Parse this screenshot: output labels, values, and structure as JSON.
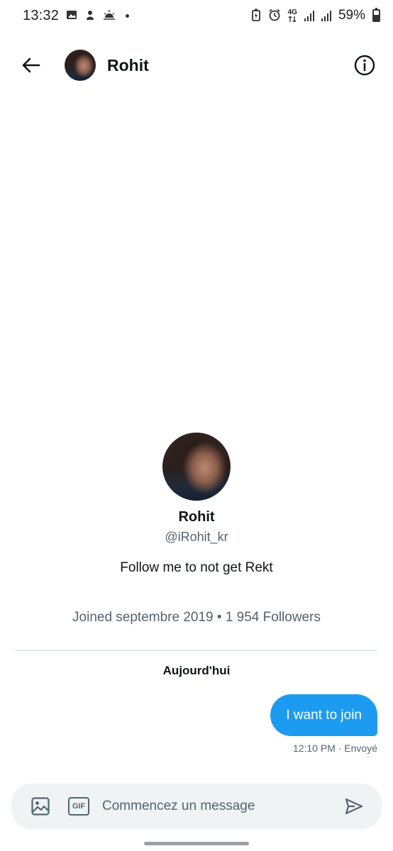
{
  "status_bar": {
    "time": "13:32",
    "network": "4G",
    "battery": "59%",
    "battery_level": 0.59
  },
  "header": {
    "name": "Rohit"
  },
  "profile": {
    "name": "Rohit",
    "handle": "@iRohit_kr",
    "bio": "Follow me to not get Rekt",
    "meta": "Joined septembre 2019 • 1 954 Followers"
  },
  "conversation": {
    "day_label": "Aujourd'hui",
    "messages": [
      {
        "text": "I  want to join",
        "meta": "12:10 PM · Envoyé"
      }
    ]
  },
  "composer": {
    "placeholder": "Commencez un message",
    "gif_label": "GIF"
  },
  "colors": {
    "accent": "#1d9bf0",
    "secondary_text": "#536471",
    "composer_bg": "#eff3f4"
  },
  "icons": {
    "back": "arrow-left-icon",
    "info": "info-icon",
    "media": "image-icon",
    "gif": "gif-icon",
    "send": "send-icon"
  }
}
